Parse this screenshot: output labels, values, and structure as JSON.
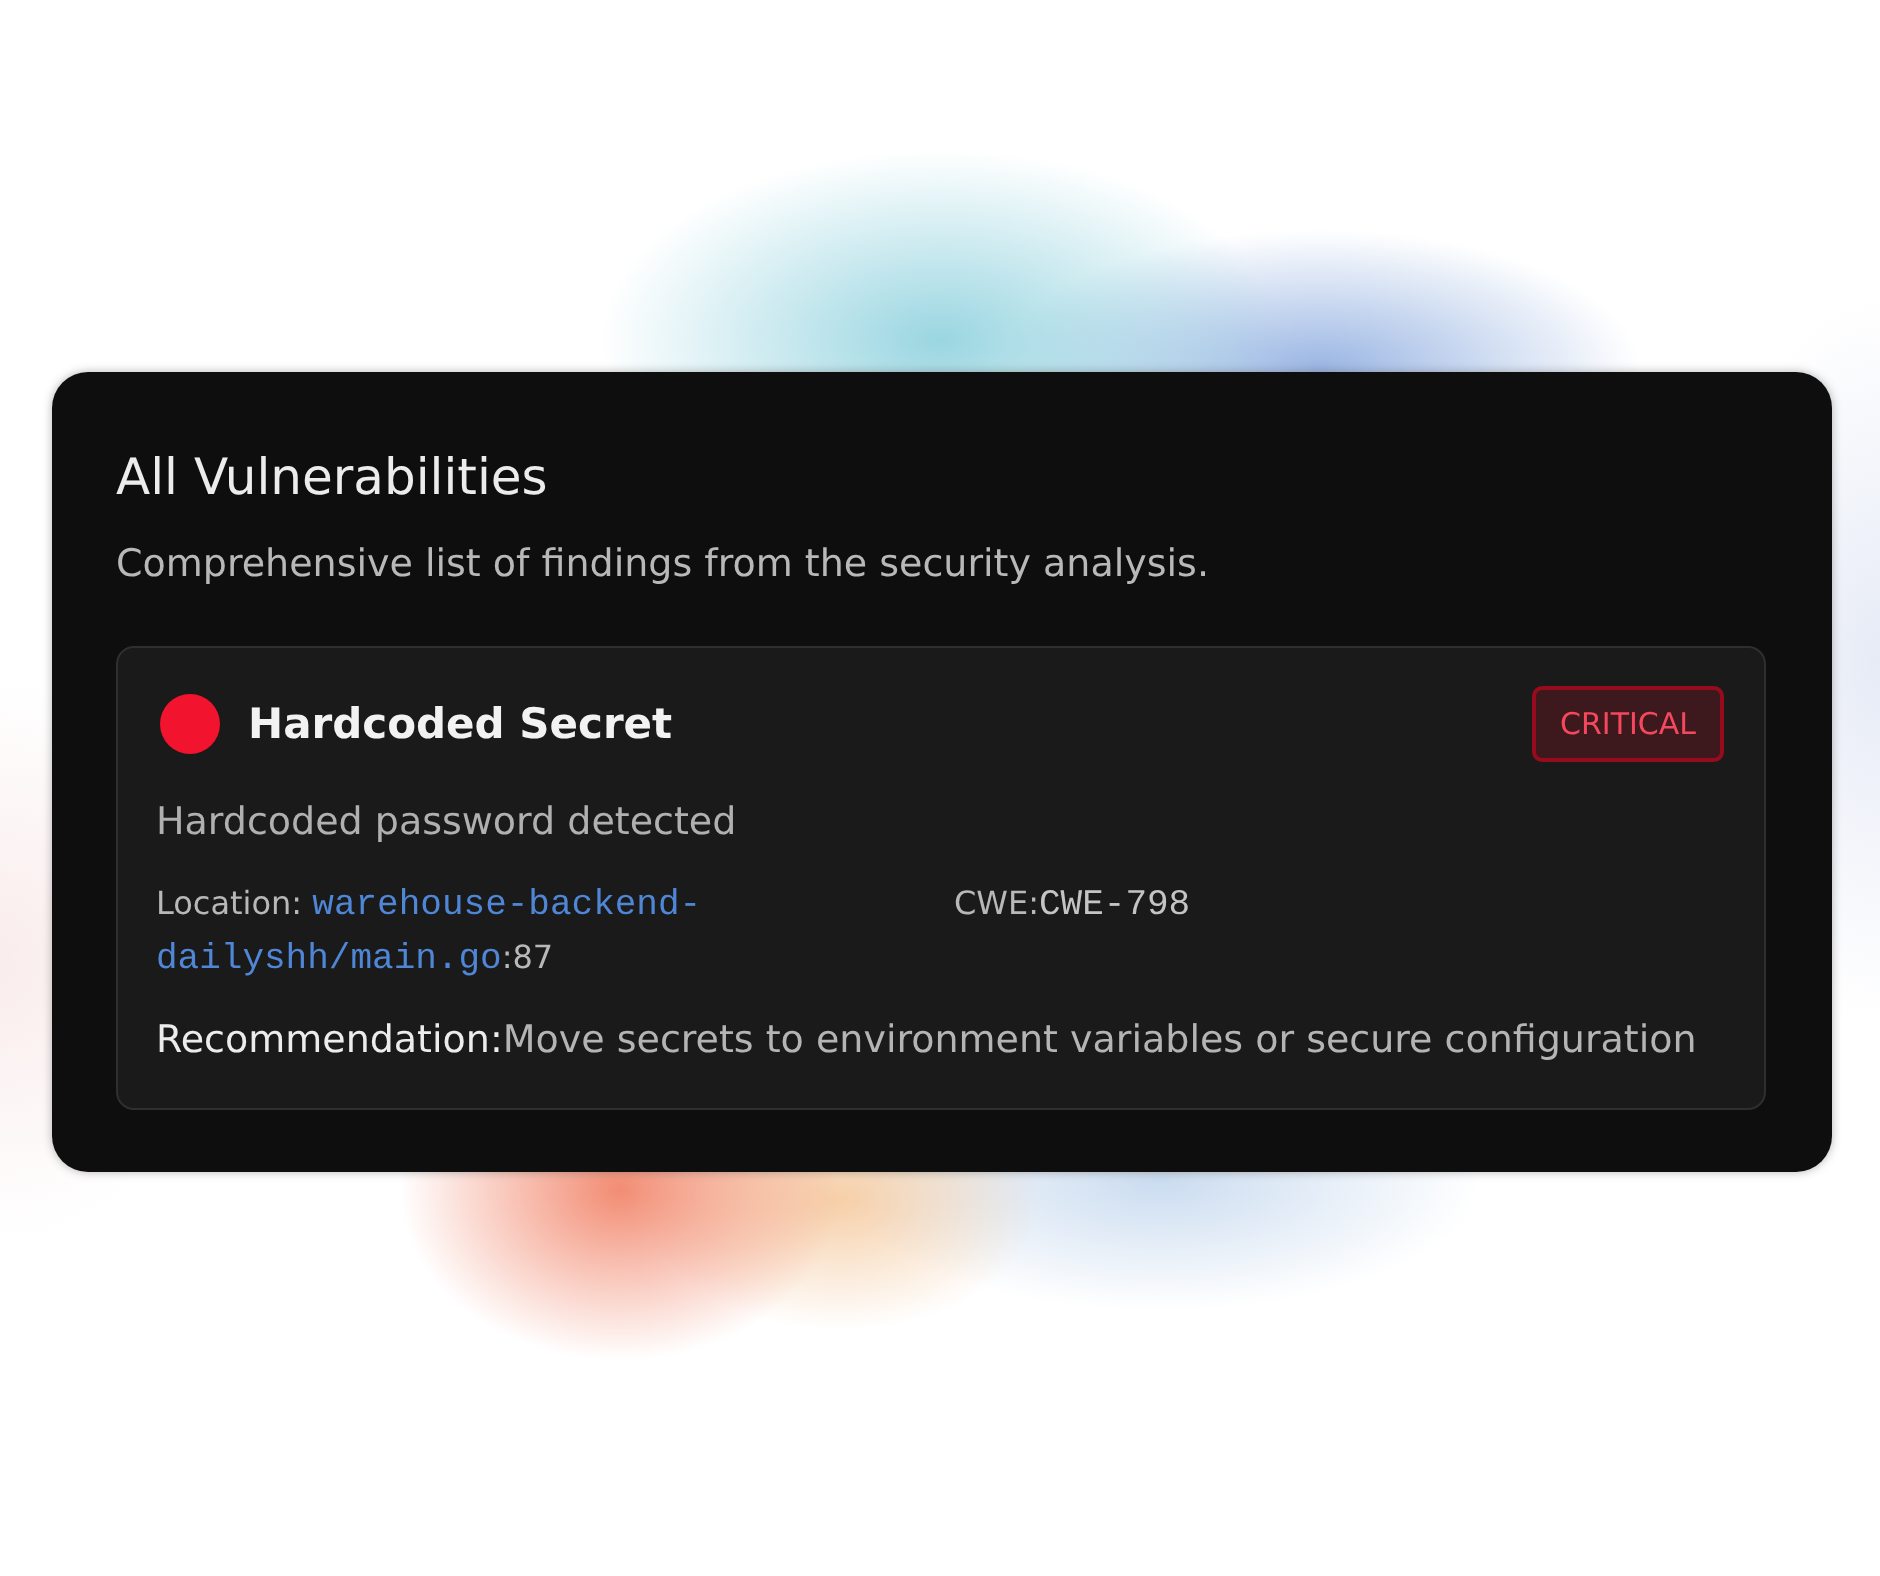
{
  "section": {
    "title": "All Vulnerabilities",
    "subtitle": "Comprehensive list of findings from the security analysis."
  },
  "findings": [
    {
      "color": "#f2132f",
      "title": "Hardcoded Secret",
      "severity": "CRITICAL",
      "description": "Hardcoded password detected",
      "location_label": "Location:",
      "file": "warehouse-backend-dailyshh/main.go",
      "line": ":87",
      "cwe_label": "CWE:",
      "cwe": "CWE-798",
      "recommendation_label": "Recommendation:",
      "recommendation": "Move secrets to environment variables or secure configuration"
    }
  ]
}
